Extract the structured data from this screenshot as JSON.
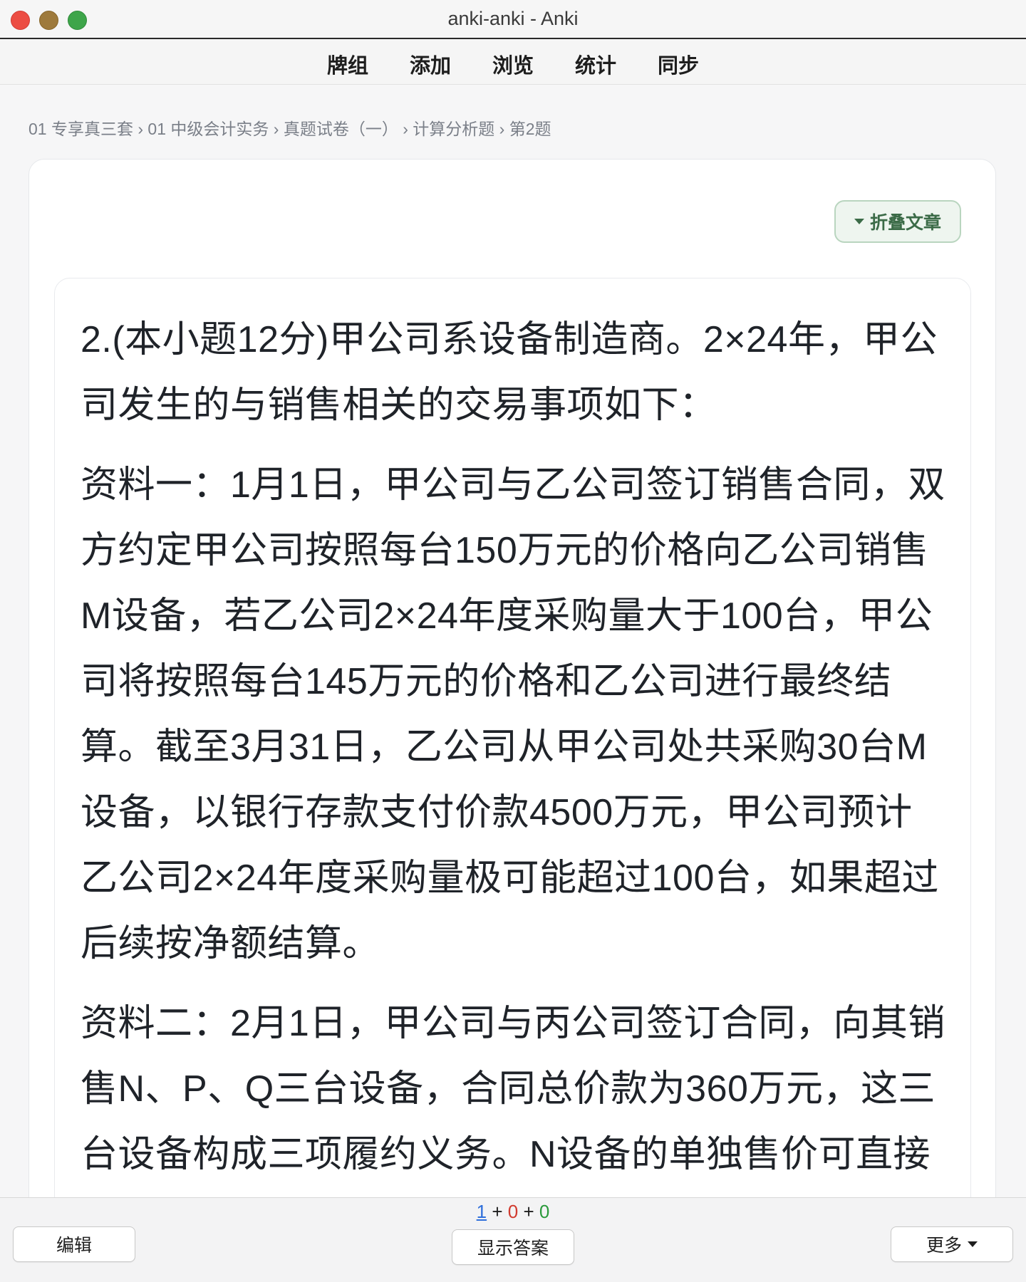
{
  "window": {
    "title": "anki-anki - Anki"
  },
  "toolbar": {
    "items": [
      {
        "label": "牌组"
      },
      {
        "label": "添加"
      },
      {
        "label": "浏览"
      },
      {
        "label": "统计"
      },
      {
        "label": "同步"
      }
    ]
  },
  "breadcrumb": {
    "text": "01 专享真三套 › 01 中级会计实务 › 真题试卷（一） › 计算分析题 › 第2题"
  },
  "card": {
    "fold_button_label": "折叠文章",
    "paragraphs": [
      "2.(本小题12分)甲公司系设备制造商。2×24年，甲公司发生的与销售相关的交易事项如下：",
      "资料一：1月1日，甲公司与乙公司签订销售合同，双方约定甲公司按照每台150万元的价格向乙公司销售M设备，若乙公司2×24年度采购量大于100台，甲公司将按照每台145万元的价格和乙公司进行最终结算。截至3月31日，乙公司从甲公司处共采购30台M设备，以银行存款支付价款4500万元，甲公司预计乙公司2×24年度采购量极可能超过100台，如果超过后续按净额结算。",
      "资料二：2月1日，甲公司与丙公司签订合同，向其销售N、P、Q三台设备，合同总价款为360万元，这三台设备构成三项履约义务。N设备的单独售价可直接"
    ]
  },
  "bottombar": {
    "edit_label": "编辑",
    "show_answer_label": "显示答案",
    "more_label": "更多",
    "counts": {
      "new": "1",
      "plus1": "+",
      "learn": "0",
      "plus2": "+",
      "review": "0"
    }
  },
  "colors": {
    "new_count": "#2f6fdb",
    "learn_count": "#d13b2f",
    "review_count": "#2b9a3c",
    "fold_button_bg": "#eef5ef",
    "fold_button_text": "#3b6b47"
  }
}
